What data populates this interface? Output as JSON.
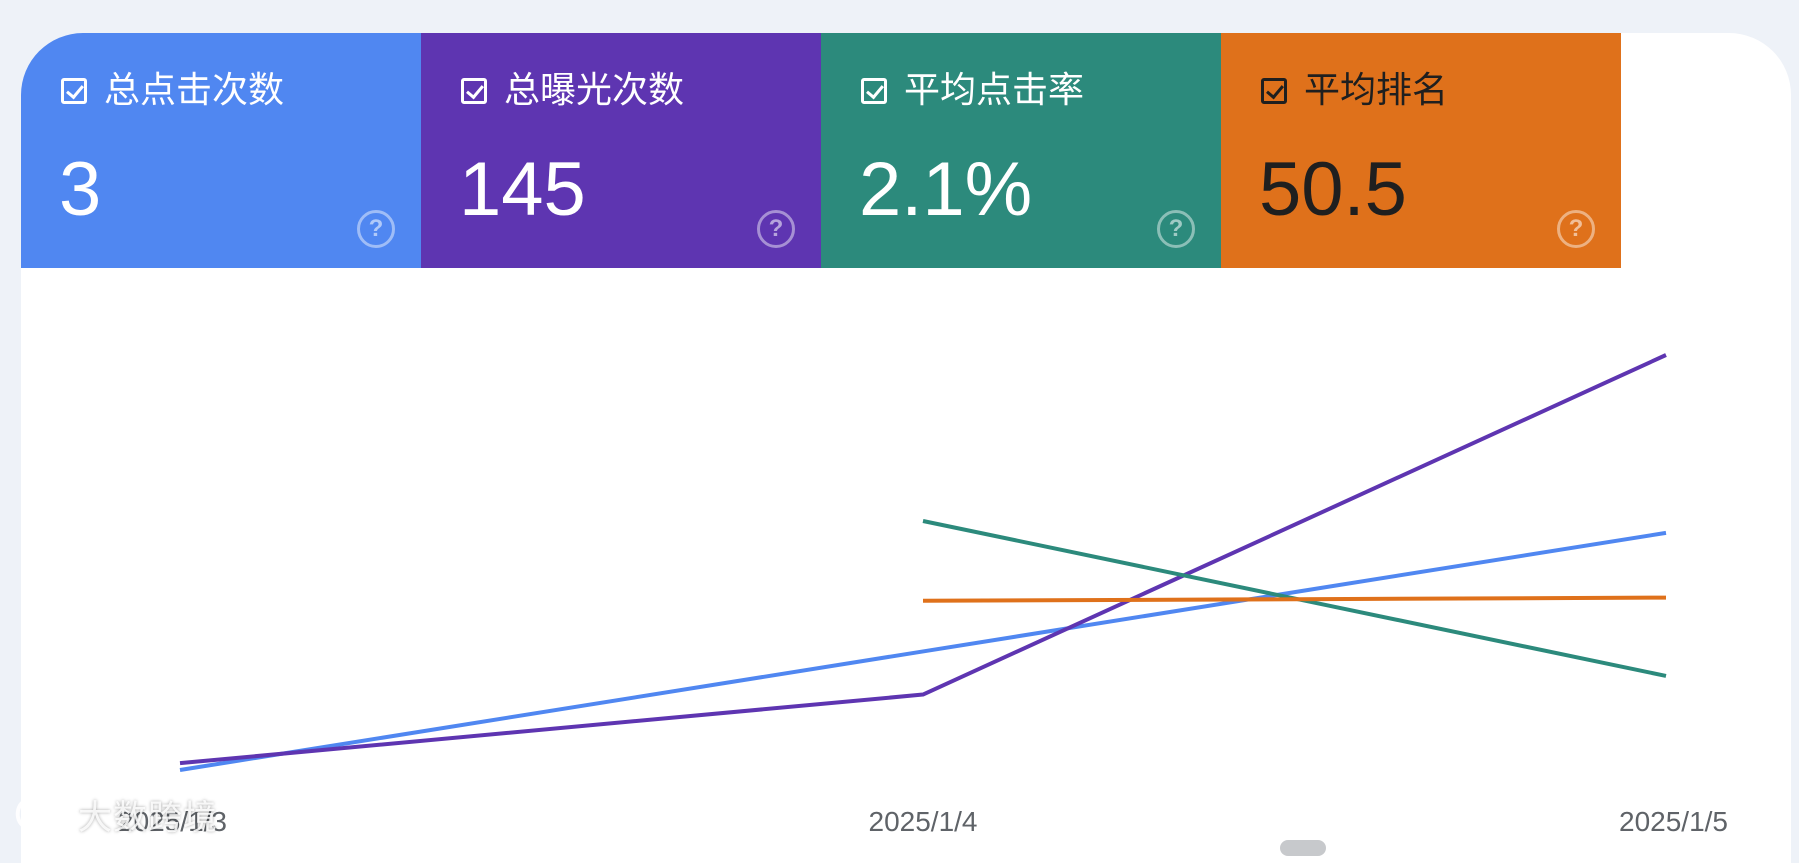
{
  "cards": [
    {
      "label": "总点击次数",
      "value": "3",
      "color": "#5087f1",
      "text_color": "#ffffff",
      "help": "?"
    },
    {
      "label": "总曝光次数",
      "value": "145",
      "color": "#5e35b1",
      "text_color": "#ffffff",
      "help": "?"
    },
    {
      "label": "平均点击率",
      "value": "2.1%",
      "color": "#2c8a7c",
      "text_color": "#ffffff",
      "help": "?"
    },
    {
      "label": "平均排名",
      "value": "50.5",
      "color": "#df711b",
      "text_color": "#1f1f1f",
      "help": "?"
    }
  ],
  "chart_data": {
    "type": "line",
    "title": "",
    "xlabel": "",
    "ylabel": "",
    "grid": false,
    "legend": "none",
    "categories": [
      "2025/1/3",
      "2025/1/4",
      "2025/1/5"
    ],
    "series": [
      {
        "name": "总点击次数",
        "color": "#5087f1",
        "values": [
          0,
          1,
          2
        ]
      },
      {
        "name": "总曝光次数",
        "color": "#5e35b1",
        "values": [
          2,
          22,
          121
        ]
      },
      {
        "name": "平均点击率",
        "color": "#2c8a7c",
        "values": [
          null,
          4.5,
          1.7
        ]
      },
      {
        "name": "平均排名",
        "color": "#df711b",
        "values": [
          null,
          53,
          54
        ]
      }
    ]
  },
  "watermark": {
    "text": "大数跨境"
  }
}
